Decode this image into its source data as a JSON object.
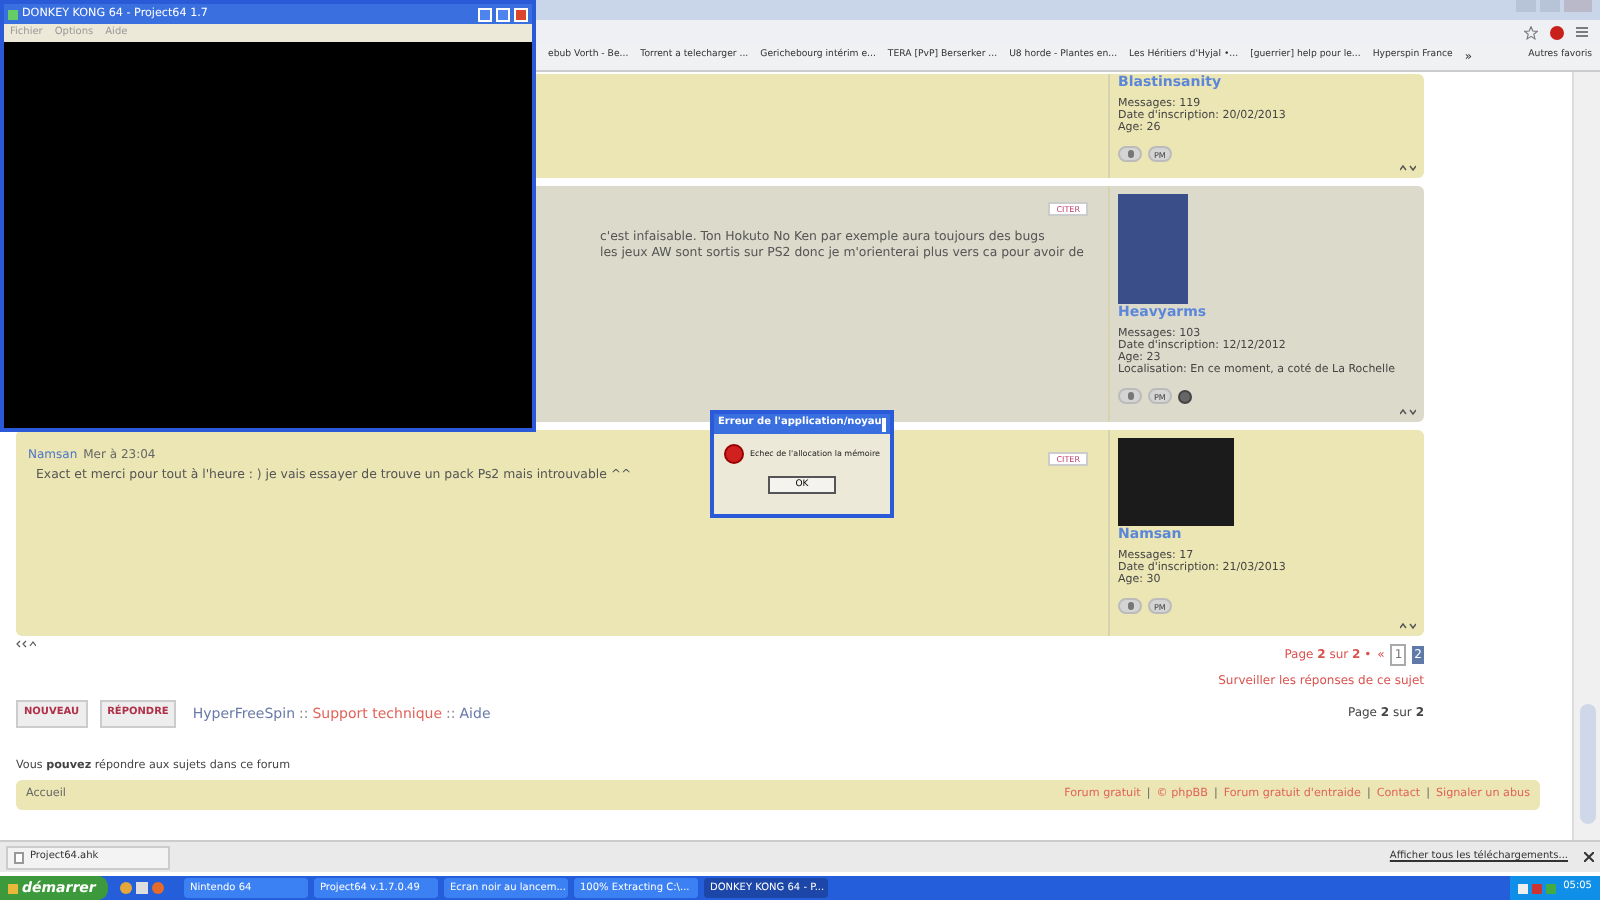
{
  "emulator_window": {
    "title": "DONKEY KONG 64 - Project64 1.7",
    "menu": [
      "Fichier",
      "Options",
      "Aide"
    ]
  },
  "browser": {
    "bookmarks": [
      "ebub Vorth - Be...",
      "Torrent a telecharger ...",
      "Gerichebourg intérim e...",
      "TERA [PvP] Berserker ...",
      "U8 horde - Plantes en...",
      "Les Héritiers d'Hyjal •...",
      "[guerrier] help pour le...",
      "Hyperspin France"
    ],
    "overflow": "»",
    "other_bookmarks": "Autres favoris"
  },
  "posts": [
    {
      "author": "Blastinsanity",
      "stats": [
        "Messages: 119",
        "Date d'inscription: 20/02/2013",
        "Age: 26"
      ],
      "actions": [
        {
          "kind": "profile"
        },
        {
          "kind": "pm",
          "label": "PM"
        }
      ]
    },
    {
      "lines": [
        "c'est infaisable. Ton Hokuto No Ken par exemple aura toujours des bugs",
        "les jeux AW sont sortis sur PS2 donc je m'orienterai plus vers ca pour avoir de"
      ],
      "quote_button": "CITER",
      "avatar": true,
      "author": "Heavyarms",
      "stats": [
        "Messages: 103",
        "Date d'inscription: 12/12/2012",
        "Age: 23",
        "Localisation: En ce moment, a coté de La Rochelle"
      ],
      "actions": [
        {
          "kind": "profile"
        },
        {
          "kind": "pm",
          "label": "PM"
        },
        {
          "kind": "web"
        }
      ]
    },
    {
      "header": [
        "Namsan",
        "Mer à 23:04"
      ],
      "lines": [
        "Exact et merci pour tout à l'heure : ) je vais essayer de trouve un pack Ps2 mais introuvable ^^"
      ],
      "quote_button": "CITER",
      "avatar": true,
      "author": "Namsan",
      "stats": [
        "Messages: 17",
        "Date d'inscription: 21/03/2013",
        "Age: 30"
      ],
      "actions": [
        {
          "kind": "profile"
        },
        {
          "kind": "pm",
          "label": "PM"
        }
      ]
    }
  ],
  "pagination": {
    "text": "Page **2** sur **2** •",
    "prev": "«",
    "pages": [
      {
        "label": "1",
        "selected": false
      },
      {
        "label": "2",
        "selected": true
      }
    ]
  },
  "watch_link": "Surveiller les réponses de ce sujet",
  "buttons": [
    "NOUVEAU",
    "RÉPONDRE"
  ],
  "breadcrumb": [
    {
      "label": "HyperFreeSpin",
      "kind": "home"
    },
    {
      "label": "Support technique",
      "kind": "link"
    },
    {
      "label": "Aide",
      "kind": "home"
    }
  ],
  "breadcrumb_separator": "::",
  "page_count": "Page **2** sur **2**",
  "permissions": "Vous **pouvez** répondre aux sujets dans ce forum",
  "footer": {
    "home": "Accueil",
    "separator": "|",
    "links": [
      "Forum gratuit",
      "© phpBB",
      "Forum gratuit d'entraide",
      "Contact",
      "Signaler un abus"
    ]
  },
  "error_dialog": {
    "title": "Erreur de l'application/noyau",
    "message": "Echec de l'allocation la mémoire",
    "button": "OK"
  },
  "download_bar": {
    "file": "Project64.ahk",
    "show_all": "Afficher tous les téléchargements..."
  },
  "taskbar": {
    "start": "démarrer",
    "tasks": [
      {
        "label": "Nintendo 64",
        "selected": false
      },
      {
        "label": "Project64 v.1.7.0.49",
        "selected": false
      },
      {
        "label": "Ecran noir au lancem...",
        "selected": false
      },
      {
        "label": "100% Extracting C:\\...",
        "selected": false
      },
      {
        "label": "DONKEY KONG 64 - P...",
        "selected": true
      }
    ],
    "clock": "05:05"
  }
}
